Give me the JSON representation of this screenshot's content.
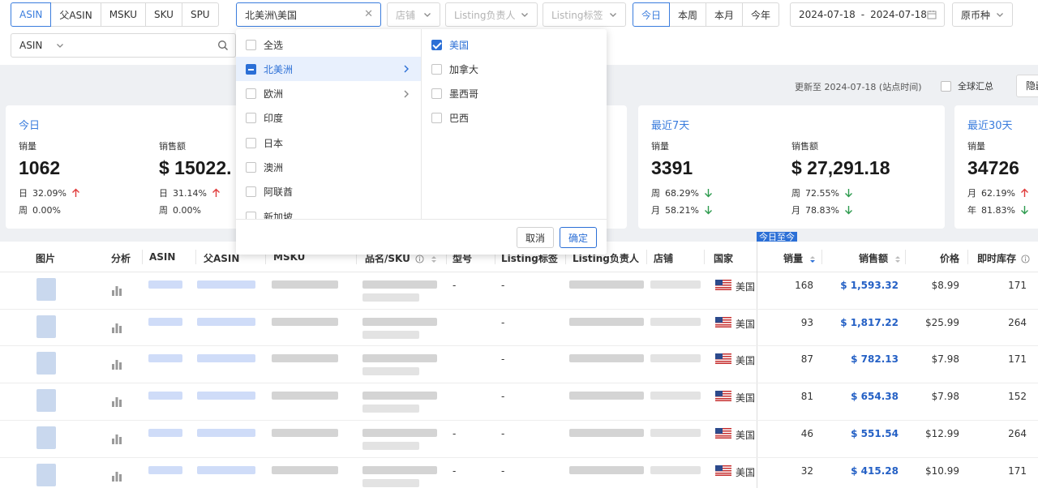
{
  "filters": {
    "id_types": [
      "ASIN",
      "父ASIN",
      "MSKU",
      "SKU",
      "SPU"
    ],
    "region_value": "北美洲\\美国",
    "shop_placeholder": "店铺",
    "owner_placeholder": "Listing负责人",
    "tag_placeholder": "Listing标签",
    "periods": [
      "今日",
      "本周",
      "本月",
      "今年"
    ],
    "date_start": "2024-07-18",
    "date_sep": "-",
    "date_end": "2024-07-18",
    "currency": "原币种",
    "search_field": "ASIN",
    "search_value": ""
  },
  "update": {
    "text": "更新至 2024-07-18 (站点时间)",
    "global_label": "全球汇总",
    "hide_label": "隐藏"
  },
  "cards": [
    {
      "title": "今日",
      "metrics": [
        {
          "label": "销量",
          "value": "1062",
          "rows": [
            {
              "k": "日",
              "v": "32.09%",
              "dir": "up"
            },
            {
              "k": "周",
              "v": "0.00%",
              "dir": "none"
            }
          ]
        },
        {
          "label": "销售额",
          "value": "$ 15022.",
          "rows": [
            {
              "k": "日",
              "v": "31.14%",
              "dir": "up"
            },
            {
              "k": "周",
              "v": "0.00%",
              "dir": "none"
            }
          ]
        }
      ]
    },
    {
      "title": "最近7天",
      "metrics": [
        {
          "label": "销量",
          "value": "3391",
          "rows": [
            {
              "k": "周",
              "v": "68.29%",
              "dir": "down"
            },
            {
              "k": "月",
              "v": "58.21%",
              "dir": "down"
            }
          ]
        },
        {
          "label": "销售额",
          "value": "$ 27,291.18",
          "rows": [
            {
              "k": "周",
              "v": "72.55%",
              "dir": "down"
            },
            {
              "k": "月",
              "v": "78.83%",
              "dir": "down"
            }
          ]
        }
      ]
    },
    {
      "title": "最近30天",
      "metrics": [
        {
          "label": "销量",
          "value": "34726",
          "rows": [
            {
              "k": "月",
              "v": "62.19%",
              "dir": "up"
            },
            {
              "k": "年",
              "v": "81.83%",
              "dir": "down"
            }
          ]
        }
      ]
    }
  ],
  "table": {
    "today_tag": "今日至今",
    "headers": {
      "image": "图片",
      "analysis": "分析",
      "asin": "ASIN",
      "parent_asin": "父ASIN",
      "msku": "MSKU",
      "name_sku": "品名/SKU",
      "model": "型号",
      "tag": "Listing标签",
      "owner": "Listing负责人",
      "shop": "店铺",
      "country": "国家",
      "qty": "销量",
      "sales": "销售额",
      "price": "价格",
      "stock": "即时库存"
    },
    "rows": [
      {
        "country": "美国",
        "model": "-",
        "tag": "-",
        "qty": "168",
        "sales": "$ 1,593.32",
        "price": "$8.99",
        "stock": "171"
      },
      {
        "country": "美国",
        "model": "",
        "tag": "-",
        "qty": "93",
        "sales": "$ 1,817.22",
        "price": "$25.99",
        "stock": "264"
      },
      {
        "country": "美国",
        "model": "",
        "tag": "-",
        "qty": "87",
        "sales": "$ 782.13",
        "price": "$7.98",
        "stock": "171"
      },
      {
        "country": "美国",
        "model": "",
        "tag": "-",
        "qty": "81",
        "sales": "$ 654.38",
        "price": "$7.98",
        "stock": "152"
      },
      {
        "country": "美国",
        "model": "-",
        "tag": "-",
        "qty": "46",
        "sales": "$ 551.54",
        "price": "$12.99",
        "stock": "264"
      },
      {
        "country": "美国",
        "model": "-",
        "tag": "-",
        "qty": "32",
        "sales": "$ 415.28",
        "price": "$10.99",
        "stock": "171"
      }
    ]
  },
  "dropdown": {
    "left_options": [
      {
        "label": "全选",
        "state": "none",
        "has_children": false,
        "highlight": false
      },
      {
        "label": "北美洲",
        "state": "indeterminate",
        "has_children": true,
        "highlight": true
      },
      {
        "label": "欧洲",
        "state": "none",
        "has_children": true,
        "highlight": false
      },
      {
        "label": "印度",
        "state": "none",
        "has_children": false,
        "highlight": false
      },
      {
        "label": "日本",
        "state": "none",
        "has_children": false,
        "highlight": false
      },
      {
        "label": "澳洲",
        "state": "none",
        "has_children": false,
        "highlight": false
      },
      {
        "label": "阿联酋",
        "state": "none",
        "has_children": false,
        "highlight": false
      },
      {
        "label": "新加坡",
        "state": "none",
        "has_children": false,
        "highlight": false
      }
    ],
    "right_options": [
      {
        "label": "美国",
        "state": "checked"
      },
      {
        "label": "加拿大",
        "state": "none"
      },
      {
        "label": "墨西哥",
        "state": "none"
      },
      {
        "label": "巴西",
        "state": "none"
      }
    ],
    "cancel_label": "取消",
    "ok_label": "确定"
  },
  "colors": {
    "accent": "#3b7ddd",
    "up": "#e03b3b",
    "down": "#2d9b4e",
    "sales_link": "#2460c5"
  }
}
